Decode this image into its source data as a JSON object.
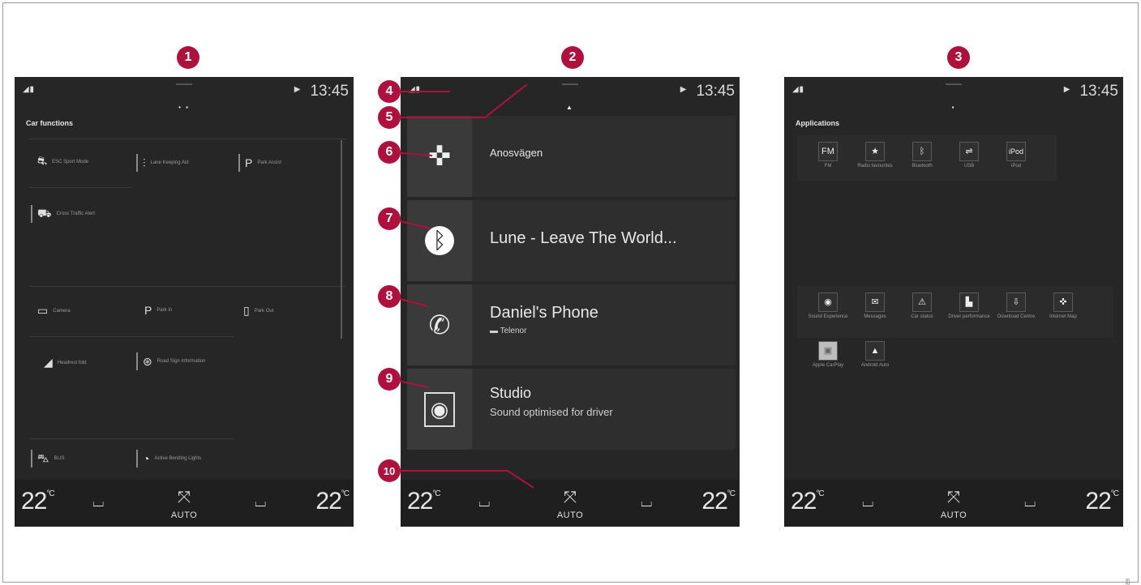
{
  "markers": [
    "1",
    "2",
    "3",
    "4",
    "5",
    "6",
    "7",
    "8",
    "9",
    "10"
  ],
  "status": {
    "clock": "13:45",
    "signal": "◢ ▮",
    "page_dots": "• ▪"
  },
  "climate": {
    "temp_left": "22",
    "temp_right": "22",
    "unit": "°C",
    "auto": "AUTO"
  },
  "screen1": {
    "section_title": "Car functions",
    "tiles": [
      {
        "icon": "esc-icon",
        "glyph": "⛐",
        "label": "ESC Sport Mode"
      },
      {
        "icon": "lane-keeping-icon",
        "glyph": "⫶",
        "label": "Lane Keeping Aid"
      },
      {
        "icon": "park-assist-icon",
        "glyph": "P",
        "label": "Park Assist"
      },
      {
        "icon": "cross-traffic-icon",
        "glyph": "⛟",
        "label": "Cross Traffic Alert"
      },
      {
        "icon": "camera-icon",
        "glyph": "▭",
        "label": "Camera"
      },
      {
        "icon": "park-in-icon",
        "glyph": "P",
        "label": "Park In"
      },
      {
        "icon": "park-out-icon",
        "glyph": "▯",
        "label": "Park Out"
      },
      {
        "icon": "headrest-icon",
        "glyph": "◢",
        "label": "Headrest fold"
      },
      {
        "icon": "road-sign-icon",
        "glyph": "⊛",
        "label": "Road Sign Information"
      },
      {
        "icon": "blis-icon",
        "glyph": "⛍",
        "label": "BLIS"
      },
      {
        "icon": "bending-lights-icon",
        "glyph": "◔",
        "label": "Active Bending Lights"
      }
    ]
  },
  "screen2": {
    "nav": {
      "icon": "compass-icon",
      "glyph": "✜",
      "title": "Anosvägen"
    },
    "media": {
      "icon": "bluetooth-icon",
      "glyph": "ᛒ",
      "title": "Lune - Leave The World..."
    },
    "phone": {
      "icon": "phone-icon",
      "glyph": "✆",
      "title": "Daniel's Phone",
      "sub": "▬ Telenor"
    },
    "audio": {
      "icon": "speaker-icon",
      "glyph": "◉",
      "title": "Studio",
      "sub": "Sound optimised for driver"
    }
  },
  "screen3": {
    "section_title": "Applications",
    "apps_top": [
      {
        "icon": "fm-icon",
        "glyph": "FM",
        "label": "FM"
      },
      {
        "icon": "radio-favourites-icon",
        "glyph": "★",
        "label": "Radio favourites"
      },
      {
        "icon": "bluetooth-icon",
        "glyph": "ᛒ",
        "label": "Bluetooth"
      },
      {
        "icon": "usb-icon",
        "glyph": "⇌",
        "label": "USB"
      },
      {
        "icon": "ipod-icon",
        "glyph": "iPod",
        "label": "iPod"
      }
    ],
    "apps_bottom": [
      {
        "icon": "sound-experience-icon",
        "glyph": "◉",
        "label": "Sound Experience"
      },
      {
        "icon": "messages-icon",
        "glyph": "✉",
        "label": "Messages"
      },
      {
        "icon": "car-status-icon",
        "glyph": "⚠",
        "label": "Car status"
      },
      {
        "icon": "driver-performance-icon",
        "glyph": "▙",
        "label": "Driver performance"
      },
      {
        "icon": "download-centre-icon",
        "glyph": "⇩",
        "label": "Download Centre"
      },
      {
        "icon": "internet-map-icon",
        "glyph": "✜",
        "label": "Internet Map"
      },
      {
        "icon": "apple-carplay-icon",
        "glyph": "▣",
        "label": "Apple CarPlay"
      },
      {
        "icon": "android-auto-icon",
        "glyph": "▲",
        "label": "Android Auto"
      }
    ]
  },
  "figure_id": "G065089"
}
